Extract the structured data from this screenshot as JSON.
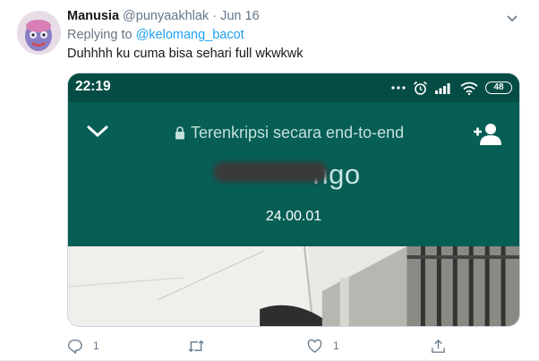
{
  "tweet": {
    "author_name": "Manusia",
    "author_handle": "@punyaakhlak",
    "separator": "·",
    "date": "Jun 16",
    "replying_prefix": "Replying to",
    "replying_to": "@kelomang_bacot",
    "text": "Duhhhh ku cuma bisa sehari full wkwkwk"
  },
  "media": {
    "status_time": "22:19",
    "battery_level": "48",
    "encryption_text": "Terenkripsi secara end-to-end",
    "contact_name_visible": "ngo",
    "call_duration": "24.00.01",
    "header_color": "#075e54"
  },
  "actions": {
    "reply_count": "1",
    "retweet_count": "",
    "like_count": "1",
    "icons": [
      "reply-icon",
      "retweet-icon",
      "like-icon",
      "share-icon"
    ]
  },
  "colors": {
    "link": "#1da1f2",
    "secondary_text": "#657786",
    "primary_text": "#14171a"
  }
}
